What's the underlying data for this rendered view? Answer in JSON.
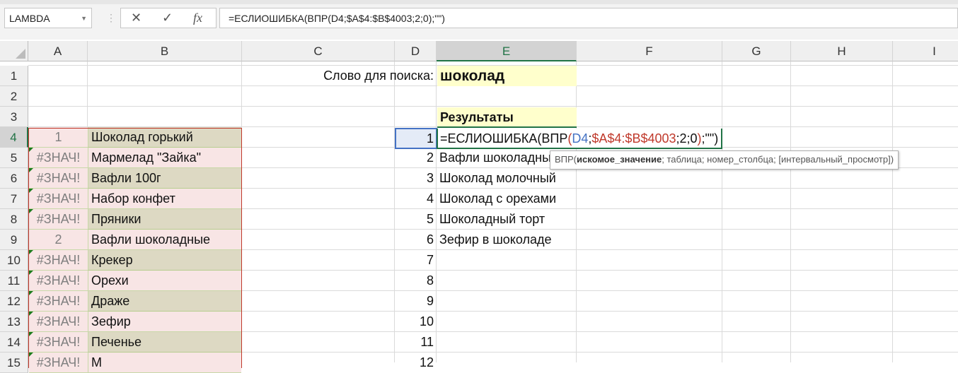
{
  "formula_bar": {
    "name_box": "LAMBDA",
    "cancel_icon": "✕",
    "enter_icon": "✓",
    "fx_icon": "fx",
    "formula": "=ЕСЛИОШИБКА(ВПР(D4;$A$4:$B$4003;2;0);\"\")"
  },
  "columns": [
    "A",
    "B",
    "C",
    "D",
    "E",
    "F",
    "G",
    "H",
    "I"
  ],
  "rows": [
    "1",
    "2",
    "3",
    "4",
    "5",
    "6",
    "7",
    "8",
    "9",
    "10",
    "11",
    "12",
    "13",
    "14",
    "15"
  ],
  "search": {
    "label": "Слово для поиска:",
    "value": "шоколад"
  },
  "results_header": "Результаты",
  "edit_formula": {
    "p1": "=ЕСЛИОШИБКА(ВПР",
    "p2": "(",
    "p3": "D4",
    "p4": ";",
    "p5": "$A$4:$B$4003",
    "p6": ";2;0",
    "p7": ")",
    "p8": ";\"\")"
  },
  "table": [
    {
      "a": "1",
      "b": "Шоколад горький"
    },
    {
      "a": "#ЗНАЧ!",
      "b": "Мармелад \"Зайка\""
    },
    {
      "a": "#ЗНАЧ!",
      "b": "Вафли 100г"
    },
    {
      "a": "#ЗНАЧ!",
      "b": "Набор конфет"
    },
    {
      "a": "#ЗНАЧ!",
      "b": "Пряники"
    },
    {
      "a": "2",
      "b": "Вафли шоколадные"
    },
    {
      "a": "#ЗНАЧ!",
      "b": "Крекер"
    },
    {
      "a": "#ЗНАЧ!",
      "b": "Орехи"
    },
    {
      "a": "#ЗНАЧ!",
      "b": "Драже"
    },
    {
      "a": "#ЗНАЧ!",
      "b": "Зефир"
    },
    {
      "a": "#ЗНАЧ!",
      "b": "Печенье"
    },
    {
      "a": "#ЗНАЧ!",
      "b": "М"
    }
  ],
  "numbers": [
    "1",
    "2",
    "3",
    "4",
    "5",
    "6",
    "7",
    "8",
    "9",
    "10",
    "11",
    "12"
  ],
  "results": [
    "",
    "Вафли шоколадные",
    "Шоколад молочный",
    "Шоколад с орехами",
    "Шоколадный торт",
    "Зефир в шоколаде"
  ],
  "tooltip": {
    "fn": "ВПР(",
    "bold": "искомое_значение",
    "rest": "; таблица; номер_столбца; [интервальный_просмотр])"
  },
  "colors": {
    "accent": "#217346",
    "pink": "#f8e5e5",
    "olive": "#ddd9c3",
    "ref_blue": "#4472c4",
    "ref_red": "#c0392b"
  }
}
